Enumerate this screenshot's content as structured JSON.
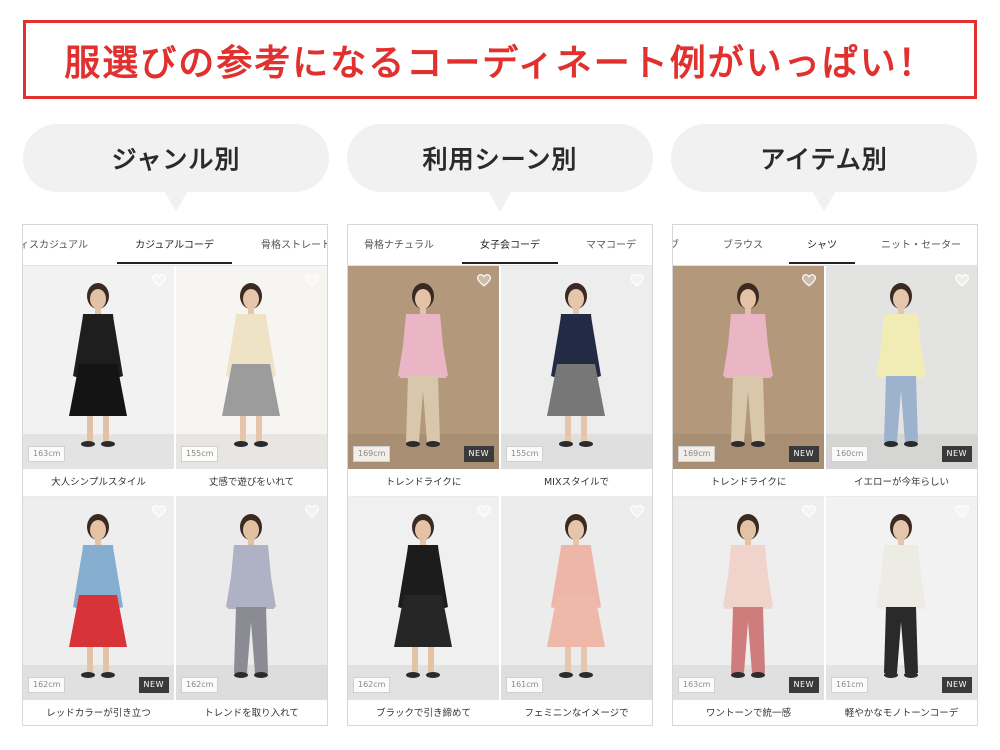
{
  "banner": {
    "text": "服選びの参考になるコーディネート例がいっぱい！",
    "color": "#e0312f"
  },
  "sections": [
    {
      "heading": "ジャンル別",
      "tabs": [
        {
          "label": "ィスカジュアル",
          "active": false
        },
        {
          "label": "カジュアルコーデ",
          "active": true
        },
        {
          "label": "骨格ストレート",
          "active": false
        }
      ],
      "items": [
        {
          "caption": "大人シンプルスタイル",
          "height": "163cm",
          "new": "",
          "bg": "#f2f2f2",
          "top": "#1e1e1e",
          "bottom": "#141414",
          "skin": "#e2c2a6",
          "dress": true
        },
        {
          "caption": "丈感で遊びをいれて",
          "height": "155cm",
          "new": "",
          "bg": "#f6f5f1",
          "top": "#efe3c6",
          "bottom": "#9c9c9c",
          "skin": "#e6c6aa",
          "dress": true
        },
        {
          "caption": "レッドカラーが引き立つ",
          "height": "162cm",
          "new": "NEW",
          "bg": "#eeeeee",
          "top": "#86aed0",
          "bottom": "#d9333a",
          "skin": "#e4c2a5",
          "dress": true
        },
        {
          "caption": "トレンドを取り入れて",
          "height": "162cm",
          "new": "",
          "bg": "#ebebeb",
          "top": "#aeb2c4",
          "bottom": "#8b8c93",
          "skin": "#e2c0a2",
          "dress": false
        }
      ]
    },
    {
      "heading": "利用シーン別",
      "tabs": [
        {
          "label": "骨格ナチュラル",
          "active": false
        },
        {
          "label": "女子会コーデ",
          "active": true
        },
        {
          "label": "ママコーデ",
          "active": false
        }
      ],
      "items": [
        {
          "caption": "トレンドライクに",
          "height": "169cm",
          "new": "NEW",
          "bg": "#b3987c",
          "top": "#eab6c6",
          "bottom": "#d8c7ab",
          "skin": "#e4c2a5",
          "dress": false
        },
        {
          "caption": "MIXスタイルで",
          "height": "155cm",
          "new": "",
          "bg": "#ededed",
          "top": "#232a44",
          "bottom": "#777777",
          "skin": "#e6c6aa",
          "dress": true
        },
        {
          "caption": "ブラックで引き締めて",
          "height": "162cm",
          "new": "",
          "bg": "#f0f0f0",
          "top": "#1c1c1c",
          "bottom": "#262626",
          "skin": "#e4c2a5",
          "dress": true
        },
        {
          "caption": "フェミニンなイメージで",
          "height": "161cm",
          "new": "",
          "bg": "#ececec",
          "top": "#edb6a8",
          "bottom": "#efb9aa",
          "skin": "#e6c6aa",
          "dress": true
        }
      ]
    },
    {
      "heading": "アイテム別",
      "tabs": [
        {
          "label": "ブ",
          "active": false
        },
        {
          "label": "ブラウス",
          "active": false
        },
        {
          "label": "シャツ",
          "active": true
        },
        {
          "label": "ニット・セーター",
          "active": false
        }
      ],
      "items": [
        {
          "caption": "トレンドライクに",
          "height": "169cm",
          "new": "NEW",
          "bg": "#b3987c",
          "top": "#eab6c6",
          "bottom": "#d8c7ab",
          "skin": "#e4c2a5",
          "dress": false
        },
        {
          "caption": "イエローが今年らしい",
          "height": "160cm",
          "new": "NEW",
          "bg": "#e3e3e1",
          "top": "#f1ecb6",
          "bottom": "#9db2cc",
          "skin": "#e6c6aa",
          "dress": false
        },
        {
          "caption": "ワントーンで統一感",
          "height": "163cm",
          "new": "NEW",
          "bg": "#eeeeee",
          "top": "#f0d4cc",
          "bottom": "#cf7c7d",
          "skin": "#e4c2a5",
          "dress": false
        },
        {
          "caption": "軽やかなモノトーンコーデ",
          "height": "161cm",
          "new": "NEW",
          "bg": "#f2f2f2",
          "top": "#ecebe4",
          "bottom": "#2a2a2a",
          "skin": "#e6c6aa",
          "dress": false
        }
      ]
    }
  ]
}
